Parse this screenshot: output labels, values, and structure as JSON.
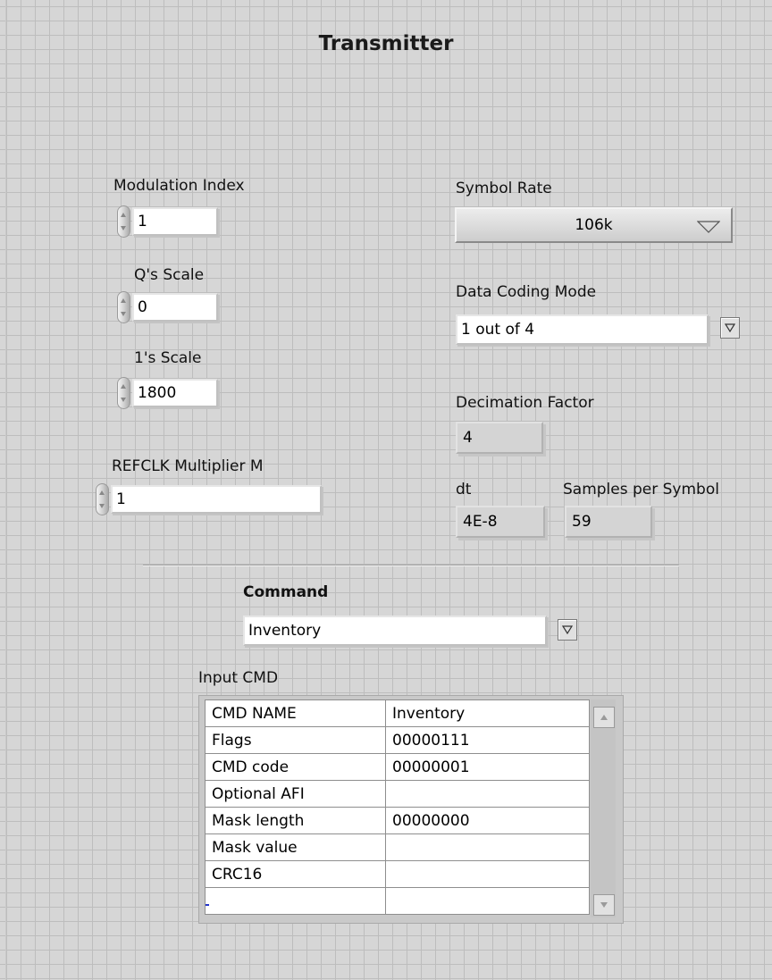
{
  "title": "Transmitter",
  "modulation_index": {
    "label": "Modulation Index",
    "value": "1"
  },
  "q_scale": {
    "label": "Q's Scale",
    "value": "0"
  },
  "one_scale": {
    "label": "1's Scale",
    "value": "1800"
  },
  "refclk": {
    "label": "REFCLK Multiplier M",
    "value": "1"
  },
  "symbol_rate": {
    "label": "Symbol Rate",
    "value": "106k"
  },
  "data_coding": {
    "label": "Data Coding Mode",
    "value": "1 out of 4"
  },
  "decimation": {
    "label": "Decimation Factor",
    "value": "4"
  },
  "dt": {
    "label": "dt",
    "value": "4E-8"
  },
  "samples_per_symbol": {
    "label": "Samples per Symbol",
    "value": "59"
  },
  "command": {
    "label": "Command",
    "value": "Inventory"
  },
  "input_cmd": {
    "label": "Input CMD",
    "rows": [
      {
        "name": "CMD NAME",
        "value": "Inventory"
      },
      {
        "name": "Flags",
        "value": "00000111"
      },
      {
        "name": "CMD code",
        "value": "00000001"
      },
      {
        "name": "Optional AFI",
        "value": ""
      },
      {
        "name": "Mask length",
        "value": "00000000"
      },
      {
        "name": "Mask value",
        "value": ""
      },
      {
        "name": "CRC16",
        "value": ""
      },
      {
        "name": "",
        "value": ""
      }
    ]
  },
  "icons": {
    "increment": "increment-decrement-arrows-icon",
    "dropdown": "down-triangle-icon",
    "scroll_up": "scroll-up-arrow-icon",
    "scroll_down": "scroll-down-arrow-icon"
  }
}
